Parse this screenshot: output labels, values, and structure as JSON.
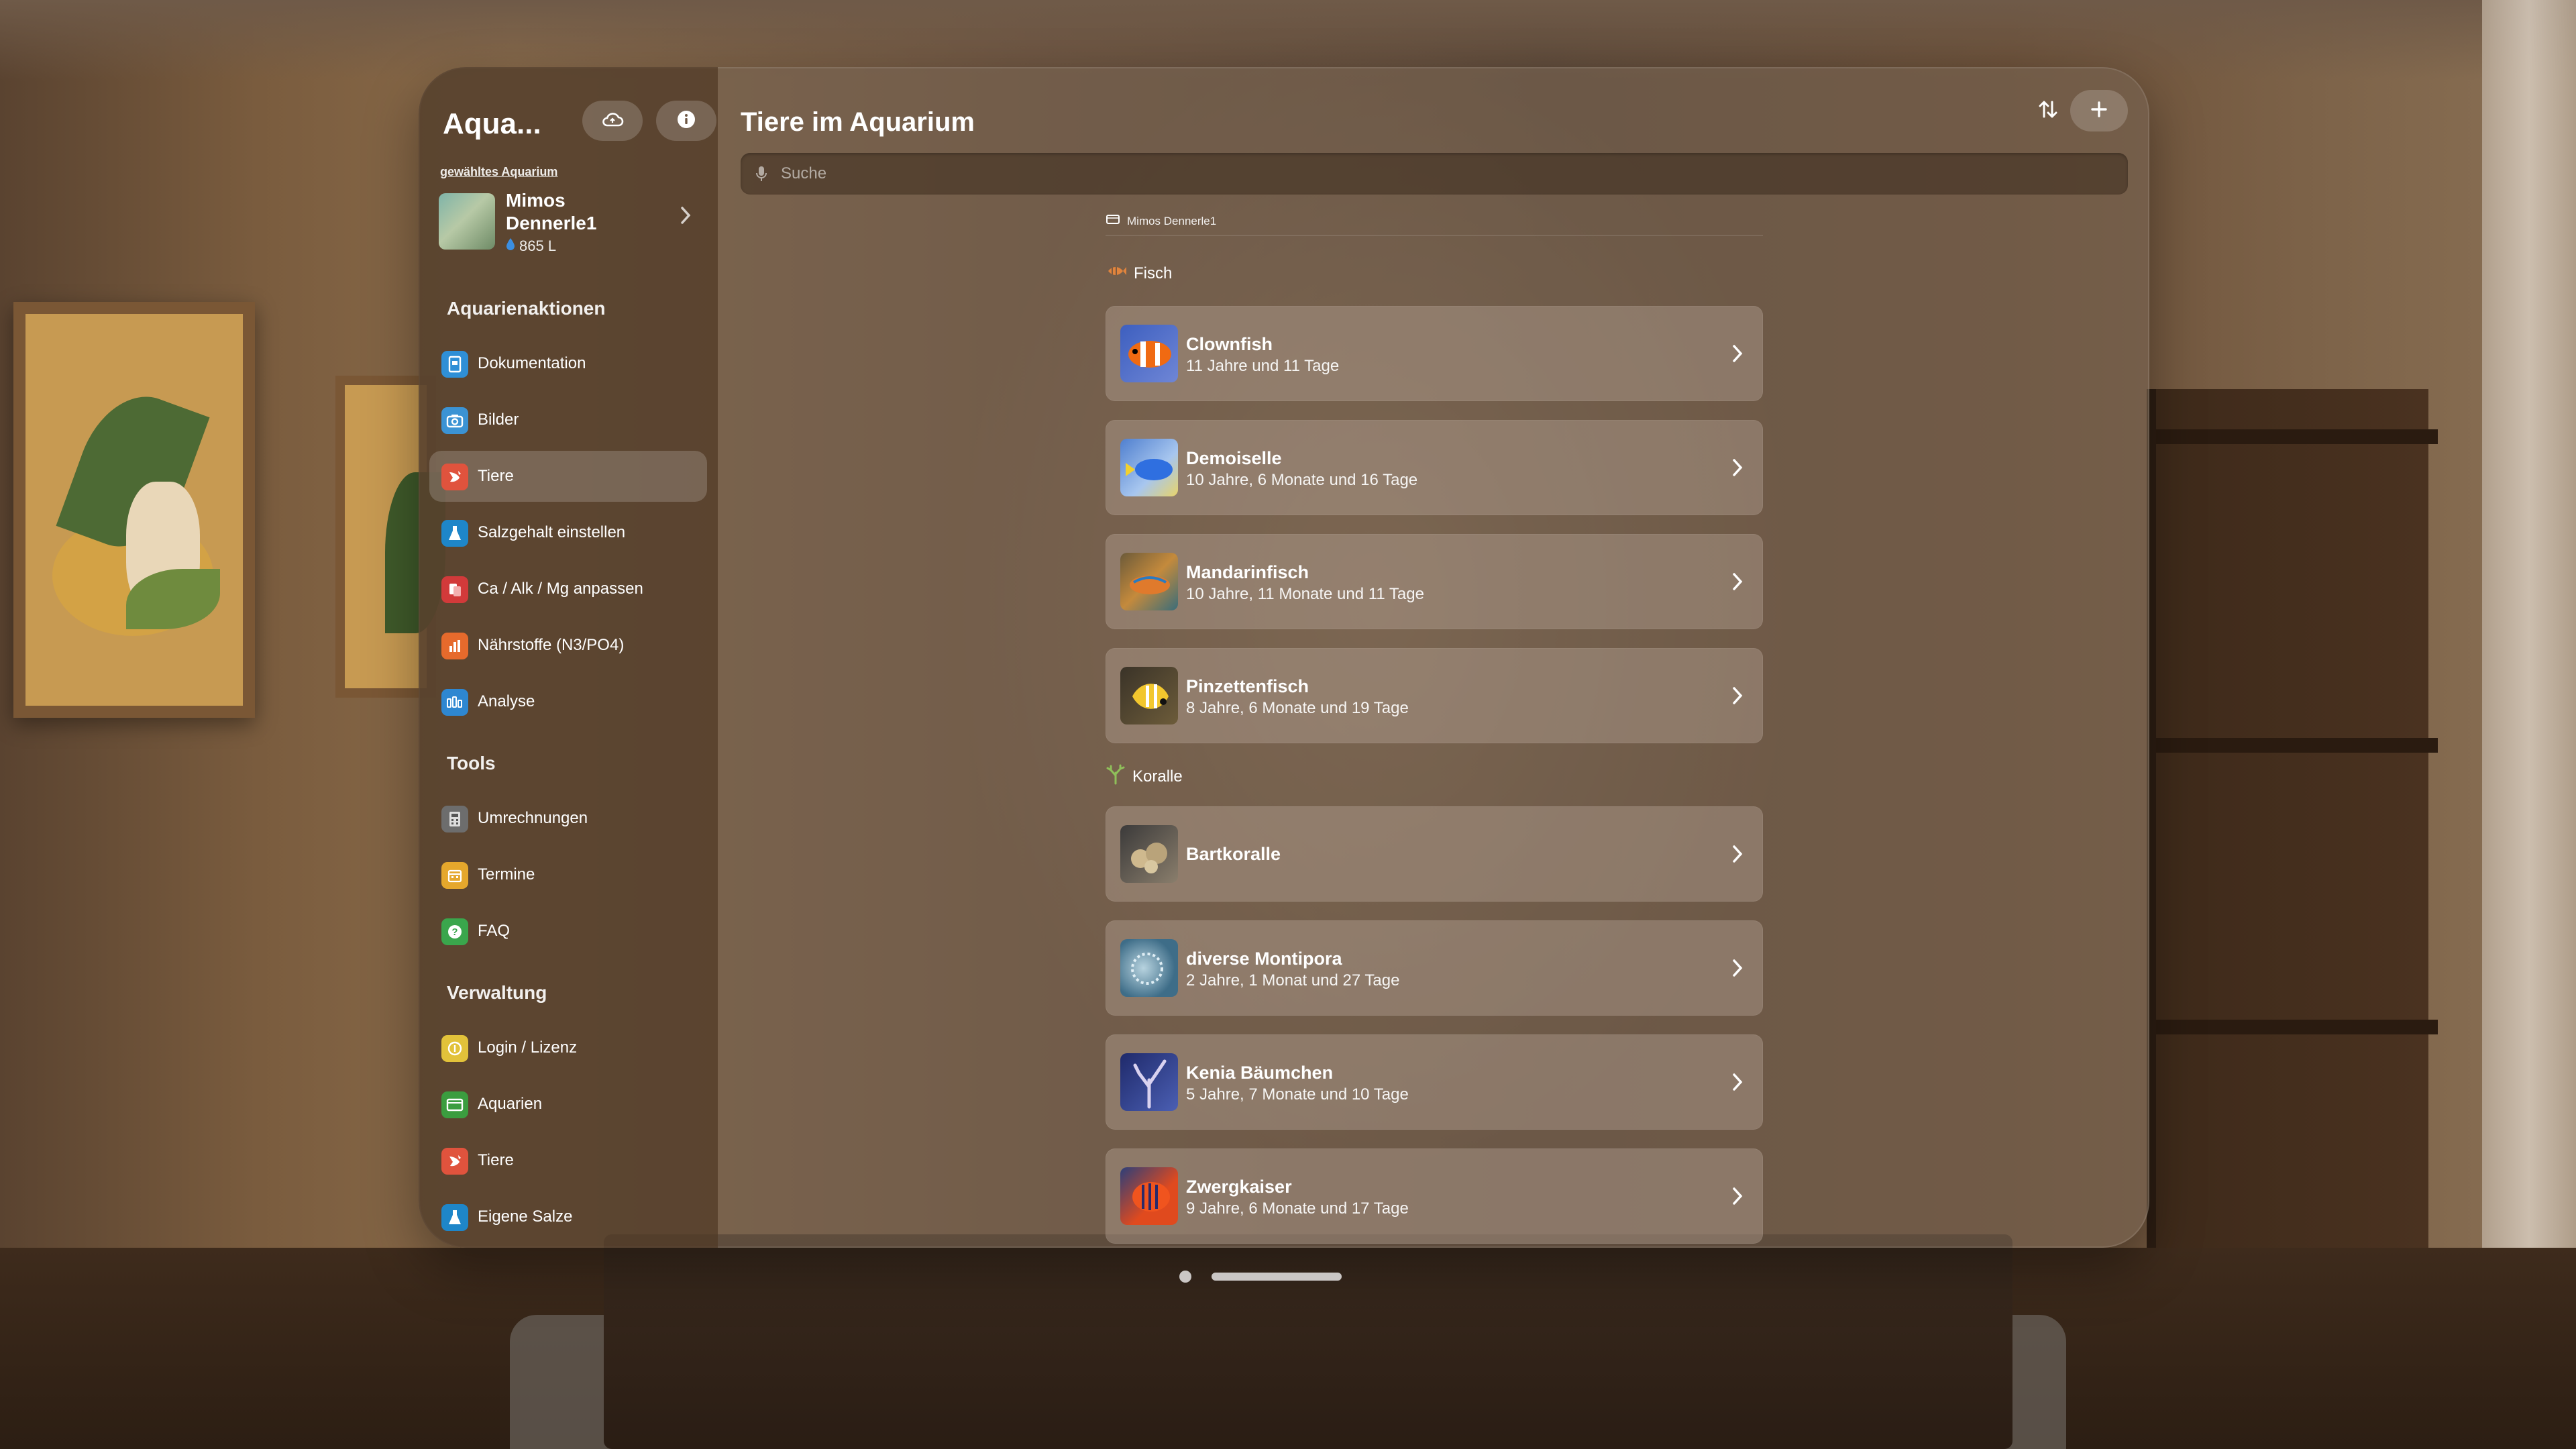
{
  "sidebar": {
    "title": "Aqua...",
    "cloud_icon": "cloud-icon",
    "info_icon": "info-icon",
    "selected_label": "gewähltes Aquarium",
    "aquarium": {
      "name": "Mimos Dennerle1",
      "volume": "865 L"
    },
    "sections": [
      {
        "title": "Aquarienaktionen",
        "items": [
          {
            "label": "Dokumentation",
            "icon": "document-icon",
            "color": "#2f8fd6"
          },
          {
            "label": "Bilder",
            "icon": "camera-icon",
            "color": "#3b93d4"
          },
          {
            "label": "Tiere",
            "icon": "fish-icon",
            "color": "#e0533d",
            "active": true
          },
          {
            "label": "Salzgehalt einstellen",
            "icon": "flask-icon",
            "color": "#1e86c9"
          },
          {
            "label": "Ca / Alk / Mg anpassen",
            "icon": "beaker-icon",
            "color": "#d23a3a"
          },
          {
            "label": "Nährstoffe (N3/PO4)",
            "icon": "chart-bars-icon",
            "color": "#e66a2c"
          },
          {
            "label": "Analyse",
            "icon": "analysis-icon",
            "color": "#2e87d1"
          }
        ]
      },
      {
        "title": "Tools",
        "items": [
          {
            "label": "Umrechnungen",
            "icon": "calculator-icon",
            "color": "#6d6d6d"
          },
          {
            "label": "Termine",
            "icon": "calendar-icon",
            "color": "#e5a72c"
          },
          {
            "label": "FAQ",
            "icon": "question-icon",
            "color": "#3aa64c"
          }
        ]
      },
      {
        "title": "Verwaltung",
        "items": [
          {
            "label": "Login / Lizenz",
            "icon": "license-icon",
            "color": "#e2c23a"
          },
          {
            "label": "Aquarien",
            "icon": "aquarium-icon",
            "color": "#3b9d3f"
          },
          {
            "label": "Tiere",
            "icon": "fish-icon",
            "color": "#e0533d"
          },
          {
            "label": "Eigene Salze",
            "icon": "flask-icon",
            "color": "#1e86c9"
          }
        ]
      }
    ]
  },
  "main": {
    "title": "Tiere im Aquarium",
    "sort_icon": "sort-icon",
    "add_icon": "plus-icon",
    "search": {
      "placeholder": "Suche",
      "icon": "microphone-icon"
    },
    "breadcrumb": "Mimos Dennerle1",
    "groups": [
      {
        "title": "Fisch",
        "icon": "fish-group-icon",
        "items": [
          {
            "name": "Clownfish",
            "age": "11 Jahre und 11 Tage"
          },
          {
            "name": "Demoiselle",
            "age": "10 Jahre, 6 Monate und 16 Tage"
          },
          {
            "name": "Mandarinfisch",
            "age": "10 Jahre, 11 Monate und 11 Tage"
          },
          {
            "name": "Pinzettenfisch",
            "age": "8 Jahre, 6 Monate und 19 Tage"
          }
        ]
      },
      {
        "title": "Koralle",
        "icon": "coral-icon",
        "items": [
          {
            "name": "Bartkoralle",
            "age": ""
          },
          {
            "name": "diverse Montipora",
            "age": "2 Jahre, 1 Monat und 27 Tage"
          },
          {
            "name": "Kenia Bäumchen",
            "age": "5 Jahre, 7 Monate und 10 Tage"
          },
          {
            "name": "Zwergkaiser",
            "age": "9 Jahre, 6 Monate und 17 Tage"
          }
        ]
      }
    ]
  }
}
